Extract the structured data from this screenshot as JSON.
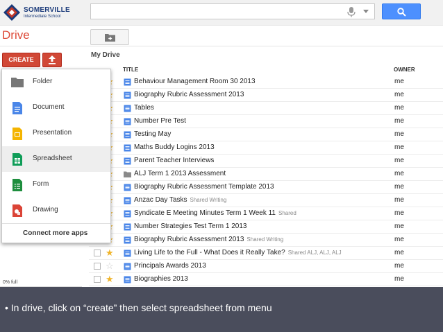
{
  "header": {
    "logo_name": "SOMERVILLE",
    "logo_sub": "Intermediate School",
    "search_placeholder": ""
  },
  "sidebar": {
    "title": "Drive",
    "create_label": "CREATE",
    "storage": "0% full"
  },
  "toolbar": {
    "section": "My Drive"
  },
  "table": {
    "headers": {
      "title": "TITLE",
      "owner": "OWNER"
    },
    "rows": [
      {
        "title": "Behaviour Management Room 30 2013",
        "tag": "",
        "owner": "me",
        "type": "document",
        "starred": true
      },
      {
        "title": "Biography Rubric Assessment 2013",
        "tag": "",
        "owner": "me",
        "type": "document",
        "starred": true
      },
      {
        "title": "Tables",
        "tag": "",
        "owner": "me",
        "type": "document",
        "starred": true
      },
      {
        "title": "Number Pre Test",
        "tag": "",
        "owner": "me",
        "type": "document",
        "starred": true
      },
      {
        "title": "Testing May",
        "tag": "",
        "owner": "me",
        "type": "document",
        "starred": true
      },
      {
        "title": "Maths Buddy Logins 2013",
        "tag": "",
        "owner": "me",
        "type": "document",
        "starred": true
      },
      {
        "title": "Parent Teacher Interviews",
        "tag": "",
        "owner": "me",
        "type": "document",
        "starred": true
      },
      {
        "title": "ALJ Term 1 2013 Assessment",
        "tag": "",
        "owner": "me",
        "type": "folder",
        "starred": true
      },
      {
        "title": "Biography Rubric Assessment Template 2013",
        "tag": "",
        "owner": "me",
        "type": "document",
        "starred": true
      },
      {
        "title": "Anzac Day Tasks",
        "tag": "Shared  Writing",
        "owner": "me",
        "type": "document",
        "starred": true
      },
      {
        "title": "Syndicate E Meeting Minutes Term 1 Week 11",
        "tag": "Shared",
        "owner": "me",
        "type": "document",
        "starred": true
      },
      {
        "title": "Number Strategies Test Term 1 2013",
        "tag": "",
        "owner": "me",
        "type": "document",
        "starred": true
      },
      {
        "title": "Biography Rubric Assessment 2013",
        "tag": "Shared  Writing",
        "owner": "me",
        "type": "document",
        "starred": true
      },
      {
        "title": "Living Life to the Full - What Does it Really Take?",
        "tag": "Shared  ALJ, ALJ, ALJ",
        "owner": "me",
        "type": "document",
        "starred": true
      },
      {
        "title": "Principals Awards 2013",
        "tag": "",
        "owner": "me",
        "type": "document",
        "starred": false
      },
      {
        "title": "Biographies 2013",
        "tag": "",
        "owner": "me",
        "type": "document",
        "starred": true
      }
    ]
  },
  "create_menu": {
    "items": [
      {
        "label": "Folder",
        "icon": "folder-icon"
      },
      {
        "label": "Document",
        "icon": "document-icon"
      },
      {
        "label": "Presentation",
        "icon": "presentation-icon"
      },
      {
        "label": "Spreadsheet",
        "icon": "spreadsheet-icon"
      },
      {
        "label": "Form",
        "icon": "form-icon"
      },
      {
        "label": "Drawing",
        "icon": "drawing-icon"
      }
    ],
    "connect_label": "Connect more apps"
  },
  "caption": {
    "text": "• In drive, click on “create” then select spreadsheet from menu"
  },
  "colors": {
    "create_red": "#d14836",
    "search_blue": "#4d90fe",
    "drive_red": "#dd4b39",
    "star_yellow": "#f0b429",
    "caption_bg": "#4a4d5c"
  }
}
